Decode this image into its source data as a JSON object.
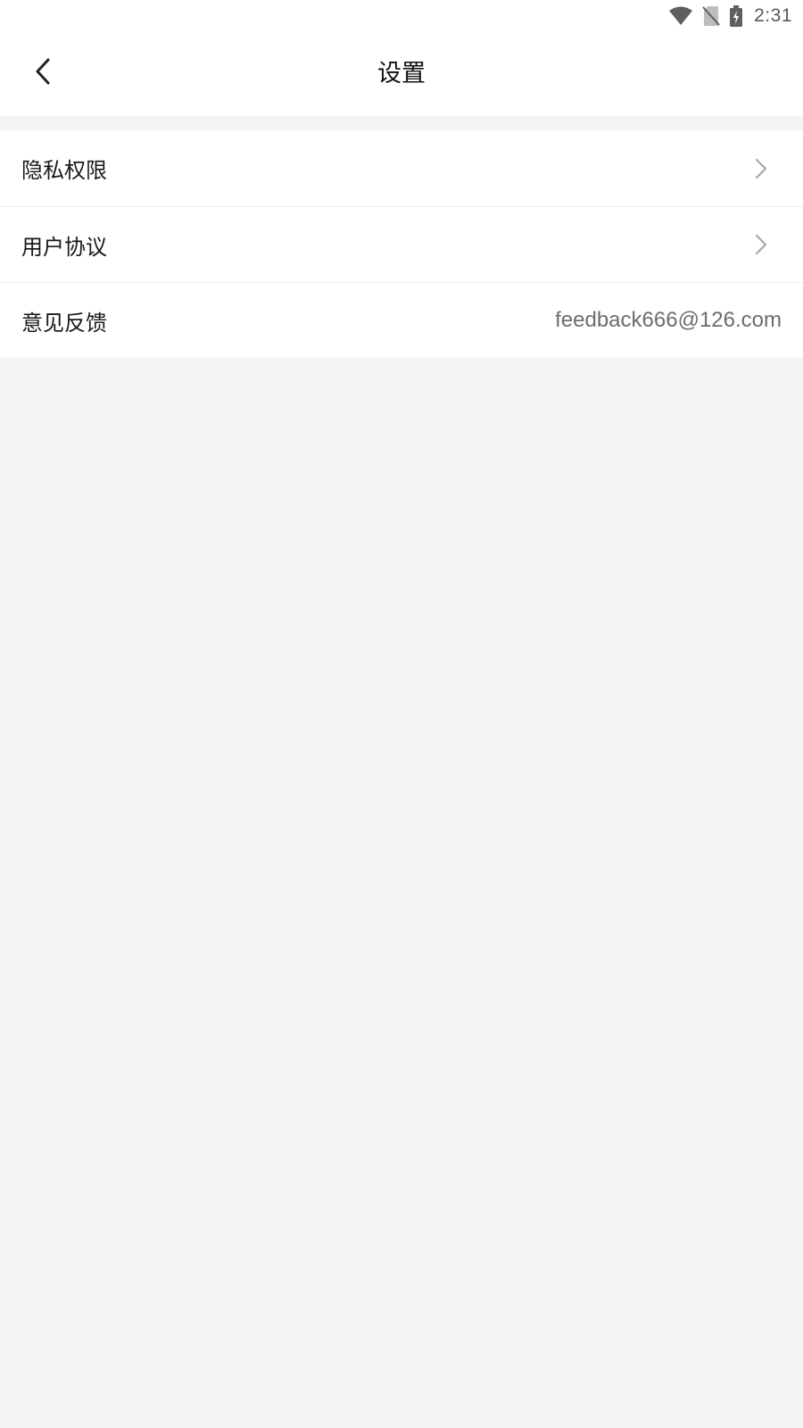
{
  "status_bar": {
    "time": "2:31",
    "icons": [
      "wifi-icon",
      "no-sim-icon",
      "battery-charging-icon"
    ]
  },
  "header": {
    "title": "设置",
    "back_icon": "chevron-left-icon"
  },
  "settings": {
    "items": [
      {
        "label": "隐私权限",
        "icon": "chevron-right-icon"
      },
      {
        "label": "用户协议",
        "icon": "chevron-right-icon"
      },
      {
        "label": "意见反馈",
        "value": "feedback666@126.com"
      }
    ]
  },
  "colors": {
    "background": "#f4f4f4",
    "surface": "#ffffff",
    "text_primary": "#1a1a1a",
    "text_secondary": "#6d6d6d",
    "chevron": "#a8a8a8",
    "divider": "#ececec"
  }
}
